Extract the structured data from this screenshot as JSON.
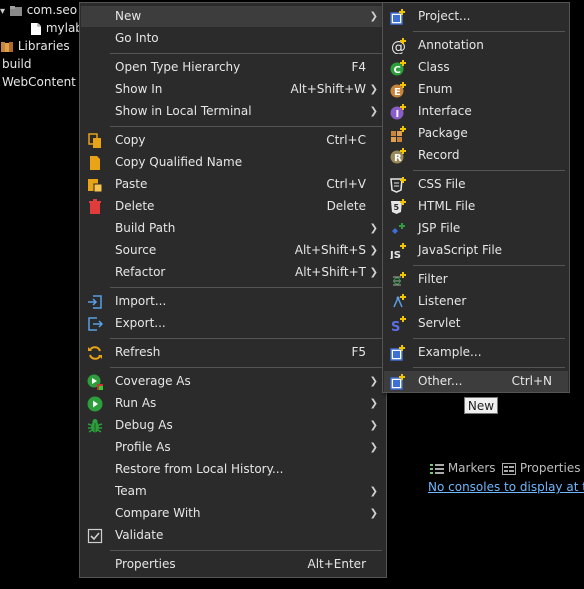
{
  "explorer": {
    "items": [
      {
        "label": "com.seo",
        "icon": "package-folder-icon"
      },
      {
        "label": "mylab",
        "icon": "file-icon"
      },
      {
        "label": "Libraries",
        "icon": "library-icon"
      },
      {
        "label": "build",
        "icon": ""
      },
      {
        "label": "WebContent",
        "icon": ""
      }
    ]
  },
  "context_menu": {
    "items": [
      {
        "label": "New",
        "accel": "",
        "submenu": true,
        "icon": "",
        "highlighted": true
      },
      {
        "label": "Go Into",
        "accel": "",
        "submenu": false,
        "icon": ""
      },
      {
        "label": "Open Type Hierarchy",
        "accel": "F4",
        "submenu": false,
        "icon": ""
      },
      {
        "label": "Show In",
        "accel": "Alt+Shift+W",
        "submenu": true,
        "icon": ""
      },
      {
        "label": "Show in Local Terminal",
        "accel": "",
        "submenu": true,
        "icon": ""
      },
      {
        "label": "Copy",
        "accel": "Ctrl+C",
        "submenu": false,
        "icon": "copy-icon"
      },
      {
        "label": "Copy Qualified Name",
        "accel": "",
        "submenu": false,
        "icon": "copy-qualified-icon"
      },
      {
        "label": "Paste",
        "accel": "Ctrl+V",
        "submenu": false,
        "icon": "paste-icon"
      },
      {
        "label": "Delete",
        "accel": "Delete",
        "submenu": false,
        "icon": "delete-icon"
      },
      {
        "label": "Build Path",
        "accel": "",
        "submenu": true,
        "icon": ""
      },
      {
        "label": "Source",
        "accel": "Alt+Shift+S",
        "submenu": true,
        "icon": ""
      },
      {
        "label": "Refactor",
        "accel": "Alt+Shift+T",
        "submenu": true,
        "icon": ""
      },
      {
        "label": "Import...",
        "accel": "",
        "submenu": false,
        "icon": "import-icon"
      },
      {
        "label": "Export...",
        "accel": "",
        "submenu": false,
        "icon": "export-icon"
      },
      {
        "label": "Refresh",
        "accel": "F5",
        "submenu": false,
        "icon": "refresh-icon"
      },
      {
        "label": "Coverage As",
        "accel": "",
        "submenu": true,
        "icon": "coverage-icon"
      },
      {
        "label": "Run As",
        "accel": "",
        "submenu": true,
        "icon": "run-icon"
      },
      {
        "label": "Debug As",
        "accel": "",
        "submenu": true,
        "icon": "debug-icon"
      },
      {
        "label": "Profile As",
        "accel": "",
        "submenu": true,
        "icon": ""
      },
      {
        "label": "Restore from Local History...",
        "accel": "",
        "submenu": false,
        "icon": ""
      },
      {
        "label": "Team",
        "accel": "",
        "submenu": true,
        "icon": ""
      },
      {
        "label": "Compare With",
        "accel": "",
        "submenu": true,
        "icon": ""
      },
      {
        "label": "Validate",
        "accel": "",
        "submenu": false,
        "icon": "checkbox-icon"
      },
      {
        "label": "Properties",
        "accel": "Alt+Enter",
        "submenu": false,
        "icon": ""
      }
    ]
  },
  "new_submenu": {
    "items": [
      {
        "label": "Project...",
        "accel": "",
        "icon": "new-project-icon"
      },
      {
        "label": "Annotation",
        "accel": "",
        "icon": "annotation-icon"
      },
      {
        "label": "Class",
        "accel": "",
        "icon": "class-icon"
      },
      {
        "label": "Enum",
        "accel": "",
        "icon": "enum-icon"
      },
      {
        "label": "Interface",
        "accel": "",
        "icon": "interface-icon"
      },
      {
        "label": "Package",
        "accel": "",
        "icon": "package-icon"
      },
      {
        "label": "Record",
        "accel": "",
        "icon": "record-icon"
      },
      {
        "label": "CSS File",
        "accel": "",
        "icon": "css-file-icon"
      },
      {
        "label": "HTML File",
        "accel": "",
        "icon": "html-file-icon"
      },
      {
        "label": "JSP File",
        "accel": "",
        "icon": "jsp-file-icon"
      },
      {
        "label": "JavaScript File",
        "accel": "",
        "icon": "javascript-file-icon"
      },
      {
        "label": "Filter",
        "accel": "",
        "icon": "filter-icon"
      },
      {
        "label": "Listener",
        "accel": "",
        "icon": "listener-icon"
      },
      {
        "label": "Servlet",
        "accel": "",
        "icon": "servlet-icon"
      },
      {
        "label": "Example...",
        "accel": "",
        "icon": "new-example-icon"
      },
      {
        "label": "Other...",
        "accel": "Ctrl+N",
        "icon": "new-other-icon",
        "highlighted": true
      }
    ]
  },
  "tooltip": {
    "text": "New"
  },
  "views": {
    "markers_label": "Markers",
    "properties_label": "Properties"
  },
  "console": {
    "message": "No consoles to display at this"
  },
  "colors": {
    "menu_bg": "#2b2b2b",
    "highlight_bg": "#3d3d3d",
    "text": "#e6e6e6",
    "link": "#6fb7ff"
  }
}
